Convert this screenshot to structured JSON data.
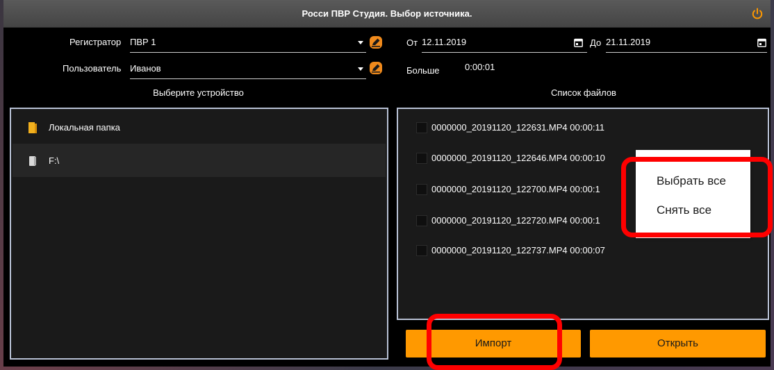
{
  "window": {
    "title": "Росси ПВР Студия. Выбор источника."
  },
  "source": {
    "registrar_label": "Регистратор",
    "registrar_value": "ПВР 1",
    "user_label": "Пользователь",
    "user_value": "Иванов"
  },
  "filter": {
    "from_label": "От",
    "from_value": "12.11.2019",
    "to_label": "До",
    "to_value": "21.11.2019",
    "more_label": "Больше",
    "more_value": "0:00:01"
  },
  "devices": {
    "title": "Выберите устройство",
    "items": [
      {
        "label": "Локальная папка",
        "icon": "folder-icon"
      },
      {
        "label": "F:\\",
        "icon": "drive-icon"
      }
    ]
  },
  "files": {
    "title": "Список файлов",
    "items": [
      {
        "name": "0000000_20191120_122631.MP4",
        "duration": "00:00:11"
      },
      {
        "name": "0000000_20191120_122646.MP4",
        "duration": "00:00:10"
      },
      {
        "name": "0000000_20191120_122700.MP4",
        "duration": "00:00:1"
      },
      {
        "name": "0000000_20191120_122720.MP4",
        "duration": "00:00:1"
      },
      {
        "name": "0000000_20191120_122737.MP4",
        "duration": "00:00:07"
      }
    ]
  },
  "context_menu": {
    "select_all": "Выбрать все",
    "deselect_all": "Снять все"
  },
  "buttons": {
    "import": "Импорт",
    "open": "Открыть"
  },
  "colors": {
    "accent": "#ff9900",
    "highlight": "#ff0000",
    "panel_border": "#b9c2d6",
    "titlebar": "#4d4d4d"
  }
}
